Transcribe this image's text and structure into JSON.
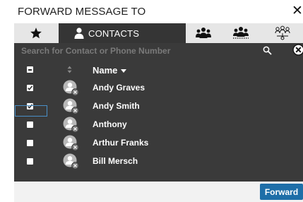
{
  "dialog": {
    "title": "FORWARD MESSAGE TO",
    "close_glyph": "✕"
  },
  "tabs": [
    {
      "id": "favorites",
      "icon": "star-icon"
    },
    {
      "id": "contacts",
      "icon": "person-icon",
      "label": "CONTACTS",
      "selected": true
    },
    {
      "id": "groups",
      "icon": "group-icon"
    },
    {
      "id": "groups-alt",
      "icon": "group-outline-icon"
    },
    {
      "id": "groups-hierarchy",
      "icon": "group-hierarchy-icon"
    }
  ],
  "search": {
    "placeholder": "Search for Contact or Phone Number",
    "value": ""
  },
  "table": {
    "header": {
      "name_label": "Name"
    },
    "rows": [
      {
        "name": "Andy Graves",
        "checked": true
      },
      {
        "name": "Andy Smith",
        "checked": true
      },
      {
        "name": "Anthony",
        "checked": false
      },
      {
        "name": "Arthur Franks",
        "checked": false
      },
      {
        "name": "Bill Mersch",
        "checked": false
      }
    ]
  },
  "footer": {
    "forward_label": "Forward"
  },
  "colors": {
    "panel": "#3a3a3a",
    "tab_selected": "#353535",
    "accent": "#1e6ea8"
  }
}
